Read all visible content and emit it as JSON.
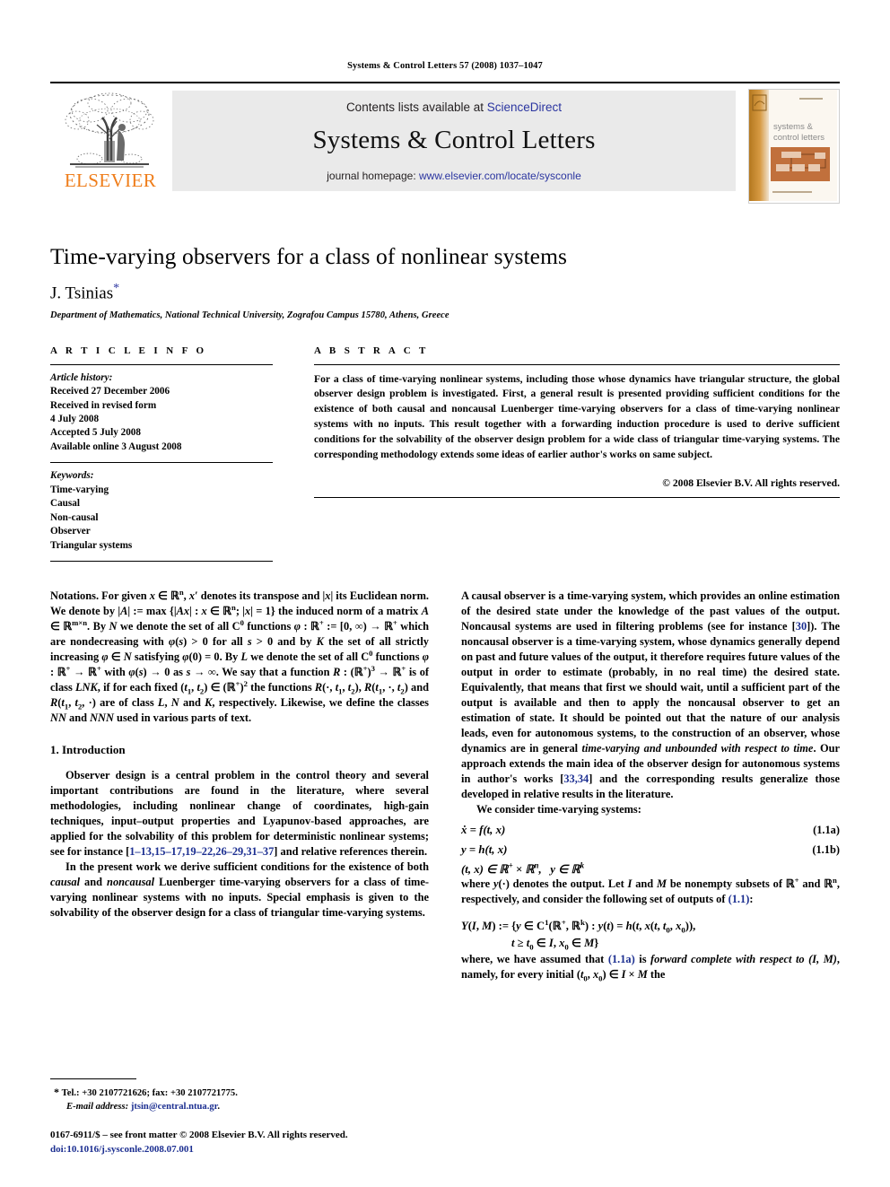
{
  "running_head": "Systems & Control Letters 57 (2008) 1037–1047",
  "masthead": {
    "contents_prefix": "Contents lists available at ",
    "contents_link": "ScienceDirect",
    "journal_title": "Systems & Control Letters",
    "homepage_label": "journal homepage: ",
    "homepage_url": "www.elsevier.com/locate/sysconle",
    "publisher_wordmark": "ELSEVIER",
    "publisher_logo_icon": "elsevier-tree-icon",
    "cover_icon": "journal-cover-thumbnail",
    "cover_title_line1": "systems &",
    "cover_title_line2": "control letters",
    "link_color": "#2b35a0",
    "brand_orange": "#ef7d1a",
    "banner_bg": "#eaeaea"
  },
  "article": {
    "title": "Time-varying observers for a class of nonlinear systems",
    "author": "J. Tsinias",
    "corresponding_marker": "*",
    "affiliation": "Department of Mathematics, National Technical University, Zografou Campus 15780, Athens, Greece"
  },
  "article_info": {
    "label": "A R T I C L E   I N F O",
    "history_label": "Article history:",
    "history": [
      "Received 27 December 2006",
      "Received in revised form",
      "4 July 2008",
      "Accepted 5 July 2008",
      "Available online 3 August 2008"
    ],
    "keywords_label": "Keywords:",
    "keywords": [
      "Time-varying",
      "Causal",
      "Non-causal",
      "Observer",
      "Triangular systems"
    ]
  },
  "abstract": {
    "label": "A B S T R A C T",
    "text": "For a class of time-varying nonlinear systems, including those whose dynamics have triangular structure, the global observer design problem is investigated. First, a general result is presented providing sufficient conditions for the existence of both causal and noncausal Luenberger time-varying observers for a class of time-varying nonlinear systems with no inputs. This result together with a forwarding induction procedure is used to derive sufficient conditions for the solvability of the observer design problem for a wide class of triangular time-varying systems. The corresponding methodology extends some ideas of earlier author's works on same subject.",
    "copyright": "© 2008 Elsevier B.V. All rights reserved."
  },
  "body": {
    "notations_heading": "Notations.",
    "notations_p1_a": " For given ",
    "notations_p1_b": ", ",
    "notations_p1_c": " denotes its transpose and ",
    "notations_p1_d": " its Euclidean norm. We denote by ",
    "notations_p1_e": " the induced norm of a matrix ",
    "notations_p1_f": ". By ",
    "notations_p1_g": " we denote the set of all ",
    "notations_p1_h": " functions ",
    "notations_p1_i": " which are nondecreasing with ",
    "notations_p1_j": " for all ",
    "notations_p1_k": " and by ",
    "notations_p1_l": " the set of all strictly increasing ",
    "notations_p1_m": " satisfying ",
    "notations_p1_n": ". By ",
    "notations_p1_o": " we denote the set of all ",
    "notations_p1_p": " functions ",
    "notations_p1_q": " with ",
    "notations_p1_r": " as ",
    "notations_p1_s": ". We say that a function ",
    "notations_p1_t": " is of class ",
    "notations_p1_u": ", if for each fixed ",
    "notations_p1_v": " the functions ",
    "notations_p1_w": " are of class ",
    "notations_p1_x": " and ",
    "notations_p1_y": ", respectively. Likewise, we define the classes ",
    "notations_p1_z": " and ",
    "notations_p1_zz": " used in various parts of text.",
    "intro_heading": "1.  Introduction",
    "intro_p1_a": "Observer design is a central problem in the control theory and several important contributions are found in the literature, where several methodologies, including nonlinear change of coordinates, high-gain techniques, input–output properties and Lyapunov-based approaches, are applied for the solvability of this problem for deterministic nonlinear systems; see for instance [",
    "intro_p1_refs": "1–13,15–17,19–22,26–29,31–37",
    "intro_p1_b": "] and relative references therein.",
    "intro_p2_a": "In the present work we derive sufficient conditions for the existence of both ",
    "intro_p2_it1": "causal",
    "intro_p2_b": " and ",
    "intro_p2_it2": "noncausal",
    "intro_p2_c": " Luenberger time-varying observers for a class of time-varying nonlinear systems with no inputs. Special emphasis is given to the solvability of the observer design for a class of triangular time-varying systems.",
    "right_p1_a": "A causal observer is a time-varying system, which provides an online estimation of the desired state under the knowledge of the past values of the output. Noncausal systems are used in filtering problems (see for instance [",
    "right_p1_ref": "30",
    "right_p1_b": "]). The noncausal observer is a time-varying system, whose dynamics generally depend on past and future values of the output, it therefore requires future values of the output in order to estimate (probably, in no real time) the desired state. Equivalently, that means that first we should wait, until a sufficient part of the output is available and then to apply the noncausal observer to get an estimation of state. It should be pointed out that the nature of our analysis leads, even for autonomous systems, to the construction of an observer, whose dynamics are in general ",
    "right_p1_it": "time-varying and unbounded with respect to time",
    "right_p1_c": ". Our approach extends the main idea of the observer design for autonomous systems in author's works [",
    "right_p1_ref2": "33,34",
    "right_p1_d": "] and the corresponding results generalize those developed in relative results in the literature.",
    "right_p2": "We consider time-varying systems:",
    "eq_1_1a_tag": "(1.1a)",
    "eq_1_1b_tag": "(1.1b)",
    "right_p3_a": "where ",
    "right_p3_b": " denotes the output. Let ",
    "right_p3_c": " and ",
    "right_p3_d": " be nonempty subsets of ",
    "right_p3_e": " and ",
    "right_p3_f": ", respectively, and consider the following set of outputs of ",
    "right_p3_ref": "(1.1)",
    "right_p3_g": ":",
    "right_p4_a": "where, we have assumed that ",
    "right_p4_ref": "(1.1a)",
    "right_p4_b": " is ",
    "right_p4_it": "forward complete with respect to ",
    "right_p4_c": ", namely, for every initial ",
    "right_p4_d": " the"
  },
  "footnote": {
    "marker": "*",
    "tel": "Tel.: +30 2107721626; fax: +30 2107721775.",
    "email_label": "E-mail address: ",
    "email": "jtsin@central.ntua.gr",
    "email_period": ".",
    "issn_line": "0167-6911/$ – see front matter © 2008 Elsevier B.V. All rights reserved.",
    "doi_label": "doi:",
    "doi": "10.1016/j.sysconle.2008.07.001"
  }
}
